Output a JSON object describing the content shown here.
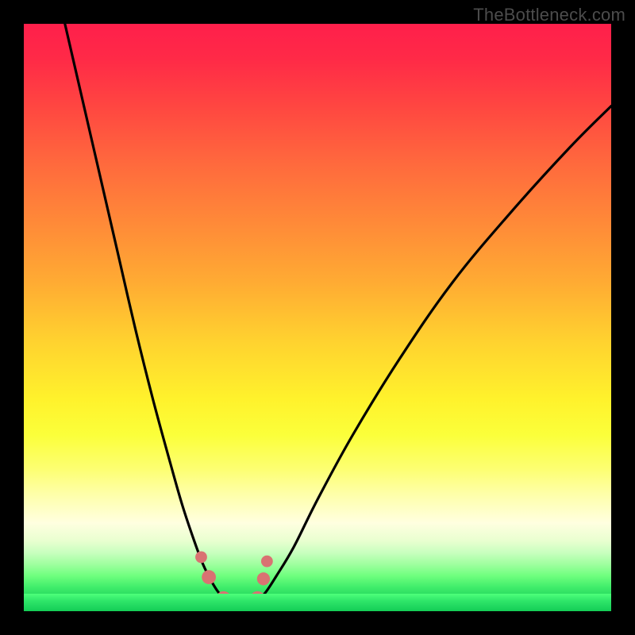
{
  "watermark": "TheBottleneck.com",
  "chart_data": {
    "type": "line",
    "title": "",
    "xlabel": "",
    "ylabel": "",
    "xlim": [
      0,
      1
    ],
    "ylim": [
      0,
      1
    ],
    "series": [
      {
        "name": "left-curve",
        "x": [
          0.07,
          0.1,
          0.13,
          0.16,
          0.19,
          0.22,
          0.25,
          0.27,
          0.29,
          0.305,
          0.32,
          0.333,
          0.346
        ],
        "y": [
          1.0,
          0.87,
          0.74,
          0.61,
          0.48,
          0.36,
          0.25,
          0.18,
          0.12,
          0.08,
          0.05,
          0.03,
          0.018
        ]
      },
      {
        "name": "right-curve",
        "x": [
          0.395,
          0.41,
          0.43,
          0.46,
          0.5,
          0.56,
          0.64,
          0.73,
          0.83,
          0.93,
          1.0
        ],
        "y": [
          0.018,
          0.03,
          0.06,
          0.11,
          0.19,
          0.3,
          0.43,
          0.56,
          0.68,
          0.79,
          0.86
        ]
      },
      {
        "name": "valley-floor",
        "x": [
          0.346,
          0.36,
          0.375,
          0.39,
          0.395
        ],
        "y": [
          0.018,
          0.009,
          0.006,
          0.009,
          0.018
        ]
      }
    ],
    "markers": [
      {
        "name": "left-marker-upper",
        "cx": 0.302,
        "cy": 0.092,
        "r": 0.01
      },
      {
        "name": "left-marker-lower",
        "cx": 0.315,
        "cy": 0.058,
        "r": 0.012
      },
      {
        "name": "right-marker-upper",
        "cx": 0.414,
        "cy": 0.085,
        "r": 0.01
      },
      {
        "name": "right-marker-lower",
        "cx": 0.408,
        "cy": 0.055,
        "r": 0.011
      },
      {
        "name": "floor-marker-1",
        "cx": 0.34,
        "cy": 0.021,
        "r": 0.013
      },
      {
        "name": "floor-marker-2",
        "cx": 0.36,
        "cy": 0.013,
        "r": 0.013
      },
      {
        "name": "floor-marker-3",
        "cx": 0.38,
        "cy": 0.013,
        "r": 0.013
      },
      {
        "name": "floor-marker-4",
        "cx": 0.398,
        "cy": 0.021,
        "r": 0.013
      }
    ],
    "marker_color": "#d97272",
    "curve_color": "#000000"
  }
}
